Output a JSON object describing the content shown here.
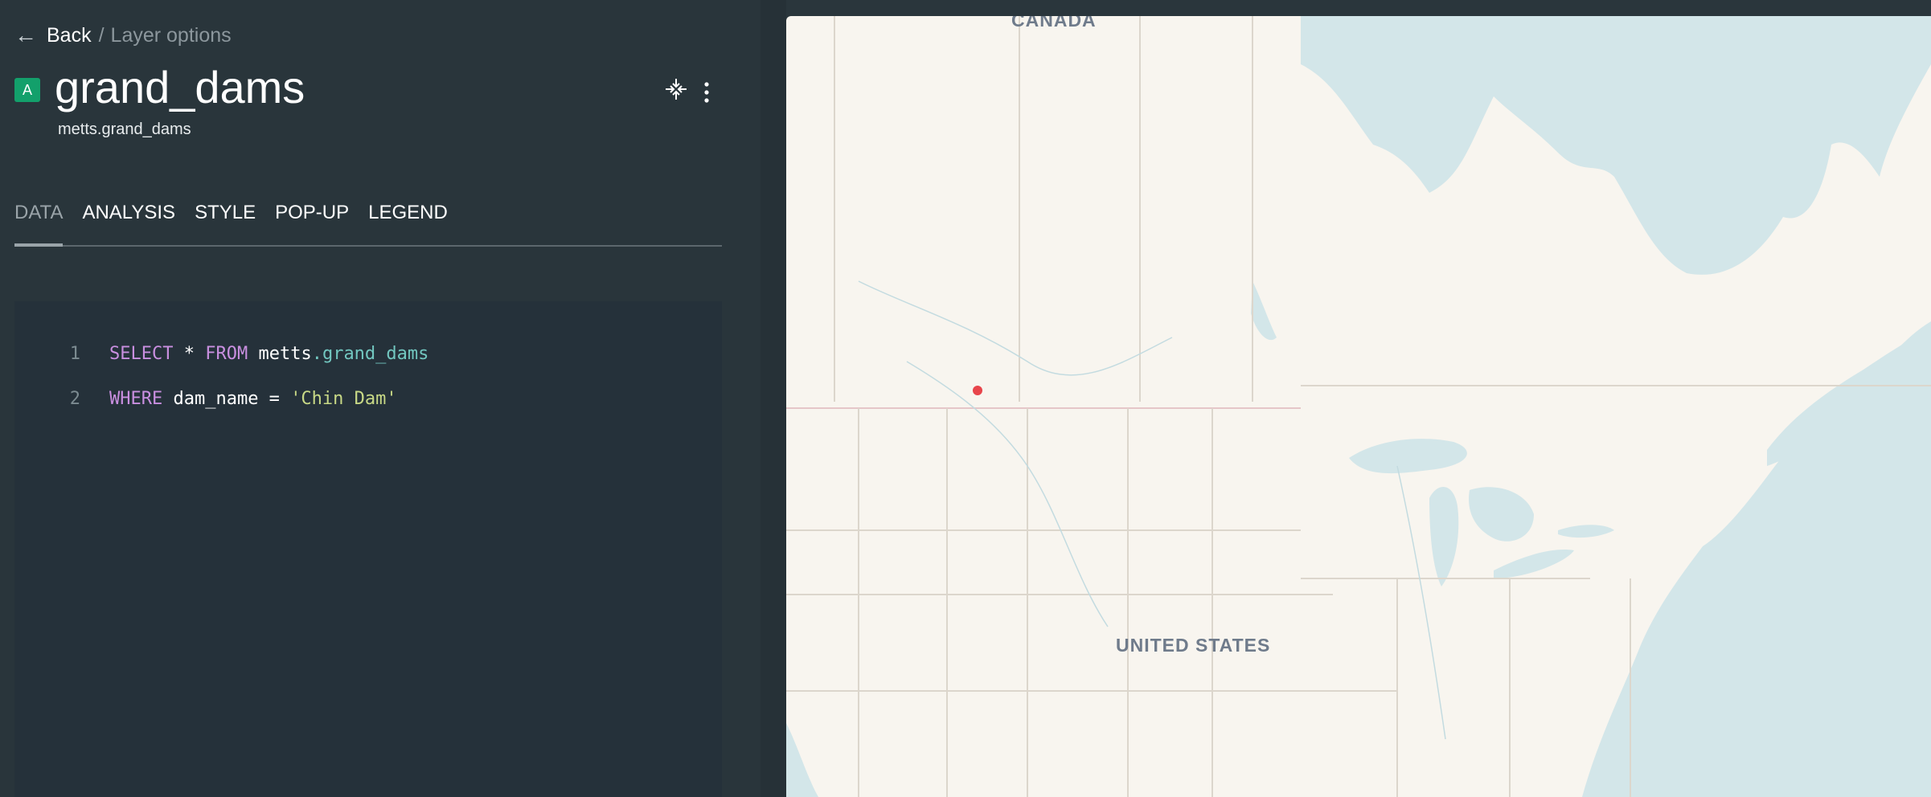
{
  "header": {
    "back_label": "Back",
    "separator": "/",
    "breadcrumb": "Layer options",
    "layer_badge": "A",
    "layer_title": "grand_dams",
    "layer_source": "metts.grand_dams"
  },
  "tabs": [
    {
      "label": "DATA",
      "active": true
    },
    {
      "label": "ANALYSIS",
      "active": false
    },
    {
      "label": "STYLE",
      "active": false
    },
    {
      "label": "POP-UP",
      "active": false
    },
    {
      "label": "LEGEND",
      "active": false
    }
  ],
  "editor": {
    "lines": [
      {
        "number": "1",
        "kw1": "SELECT",
        "text1": " * ",
        "kw2": "FROM",
        "text2": " metts",
        "table": ".grand_dams"
      },
      {
        "number": "2",
        "kw1": "WHERE",
        "text1": " dam_name = ",
        "string": "'Chin Dam'"
      }
    ]
  },
  "map": {
    "labels": {
      "canada": "CANADA",
      "usa": "UNITED STATES"
    },
    "water_color": "#d3e6e9",
    "land_color": "#f8f5ef",
    "marker_color": "#e8454b"
  }
}
